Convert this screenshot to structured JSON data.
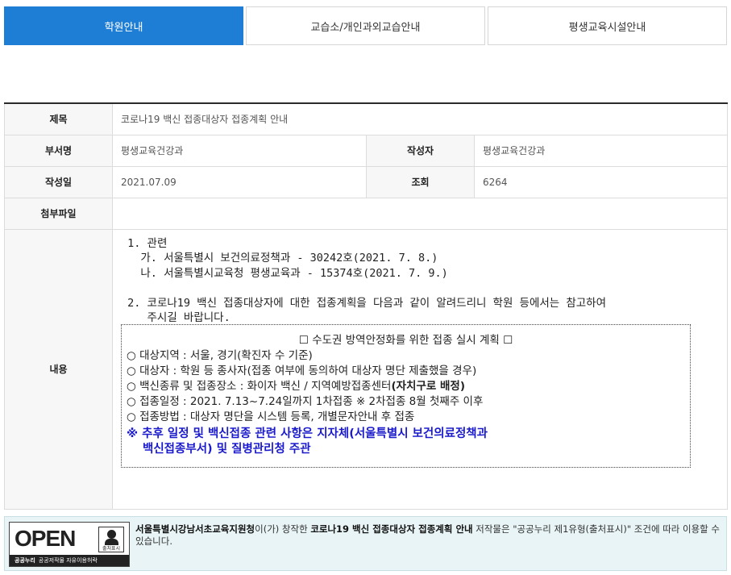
{
  "tabs": [
    {
      "label": "학원안내",
      "active": true
    },
    {
      "label": "교습소/개인과외교습안내",
      "active": false
    },
    {
      "label": "평생교육시설안내",
      "active": false
    }
  ],
  "post": {
    "title_label": "제목",
    "title": "코로나19 백신 접종대상자 접종계획 안내",
    "dept_label": "부서명",
    "dept": "평생교육건강과",
    "author_label": "작성자",
    "author": "평생교육건강과",
    "date_label": "작성일",
    "date": "2021.07.09",
    "views_label": "조회",
    "views": "6264",
    "attach_label": "첨부파일",
    "attach": "",
    "content_label": "내용"
  },
  "content": {
    "line1": " 1. 관련",
    "line2": "   가. 서울특별시 보건의료정책과 - 30242호(2021. 7. 8.)",
    "line3": "   나. 서울특별시교육청 평생교육과 - 15374호(2021. 7. 9.)",
    "line4": "",
    "line5": " 2. 코로나19 백신 접종대상자에 대한 접종계획을 다음과 같이 알려드리니 학원 등에서는 참고하여",
    "line6": "    주시길 바랍니다.",
    "plan_title": "☐ 수도권 방역안정화를 위한 접종 실시 계획 ☐",
    "plan_items": [
      "○ 대상지역 : 서울, 경기(확진자 수 기준)",
      "○ 대상자 : 학원 등 종사자(접종 여부에 동의하여 대상자 명단 제출했을 경우)",
      "○ 백신종류 및 접종장소 : 화이자 백신 / 지역예방접종센터",
      "○ 접종일정 : 2021. 7.13~7.24일까지 1차접종 ※ 2차접종 8월 첫째주 이후",
      "○ 접종방법 : 대상자 명단을 시스템 등록, 개별문자안내 후 접종"
    ],
    "plan_item3_strong": "(자치구로 배정)",
    "notice_line1": "※ 추후 일정 및 백신접종 관련 사항은 지자체(서울특별시 보건의료정책과",
    "notice_line2": "백신접종부서) 및 질병관리청 주관"
  },
  "license": {
    "open_text": "OPEN",
    "badge_text": "출처표시",
    "foot_strong": "공공누리",
    "foot_text": "공공저작물 자유이용허락",
    "org": "서울특별시강남서초교육지원청",
    "text1": "이(가) 창작한 ",
    "work": "코로나19 백신 접종대상자 접종계획 안내",
    "text2": " 저작물은 \"공공누리 제1유형(출처표시)\" 조건에 따라 이용할 수 있습니다."
  }
}
